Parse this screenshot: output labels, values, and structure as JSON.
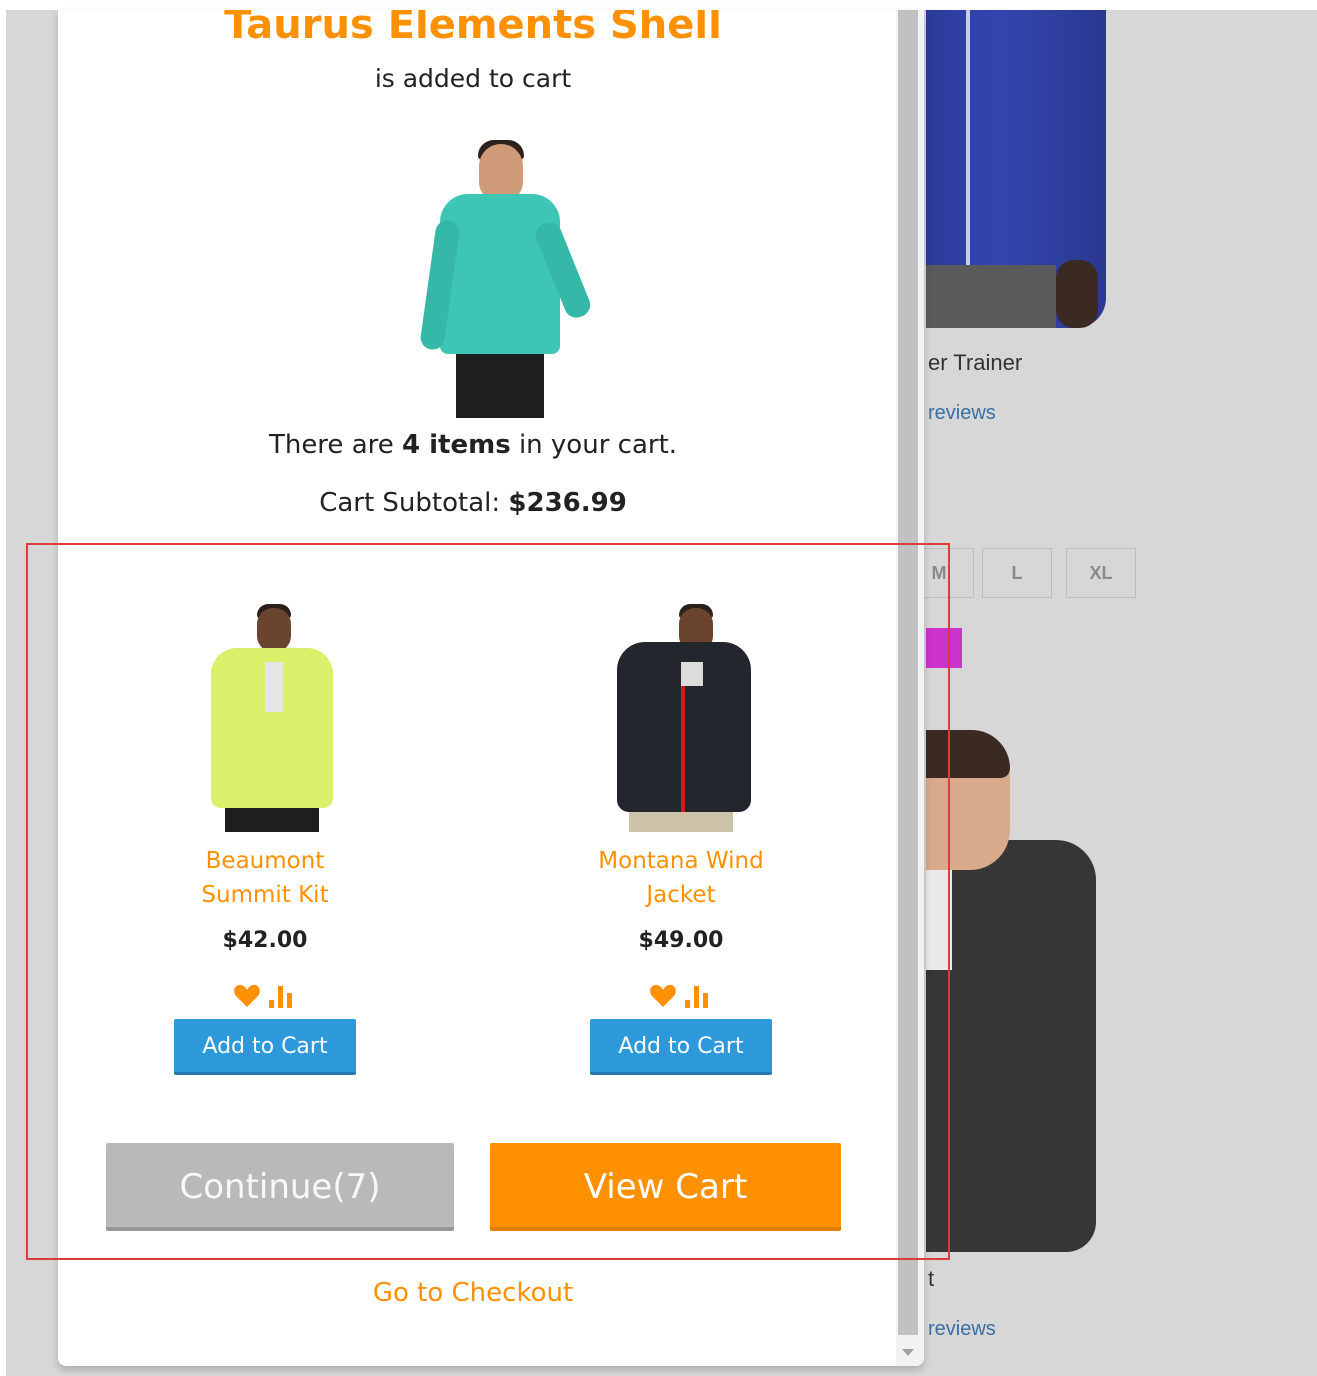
{
  "background": {
    "product_name_partial": "er Trainer",
    "reviews_link_top": "reviews",
    "sizes": [
      "M",
      "L",
      "XL"
    ],
    "product_name_partial_bottom": "t",
    "reviews_link_bottom": "reviews",
    "swatch_color": "#cc33cc"
  },
  "modal": {
    "product_title": "Taurus Elements Shell",
    "added_text": "is added to cart",
    "cart_count_prefix": "There are ",
    "cart_count_strong": "4 items",
    "cart_count_suffix": " in your cart.",
    "subtotal_label": "Cart Subtotal: ",
    "subtotal_value": "$236.99",
    "recommendations": [
      {
        "name_line1": "Beaumont",
        "name_line2": "Summit Kit",
        "price": "$42.00",
        "add_label": "Add to Cart",
        "jacket_color": "#d8f06a"
      },
      {
        "name_line1": "Montana Wind",
        "name_line2": "Jacket",
        "price": "$49.00",
        "add_label": "Add to Cart",
        "jacket_color": "#24262e"
      }
    ],
    "continue_label": "Continue(7)",
    "view_cart_label": "View Cart",
    "checkout_label": "Go to Checkout"
  },
  "icons": {
    "wishlist": "heart-icon",
    "compare": "bar-chart-icon"
  },
  "colors": {
    "accent": "#ff9000",
    "primary_button": "#2d99db",
    "highlight_border": "#e03a3a"
  }
}
